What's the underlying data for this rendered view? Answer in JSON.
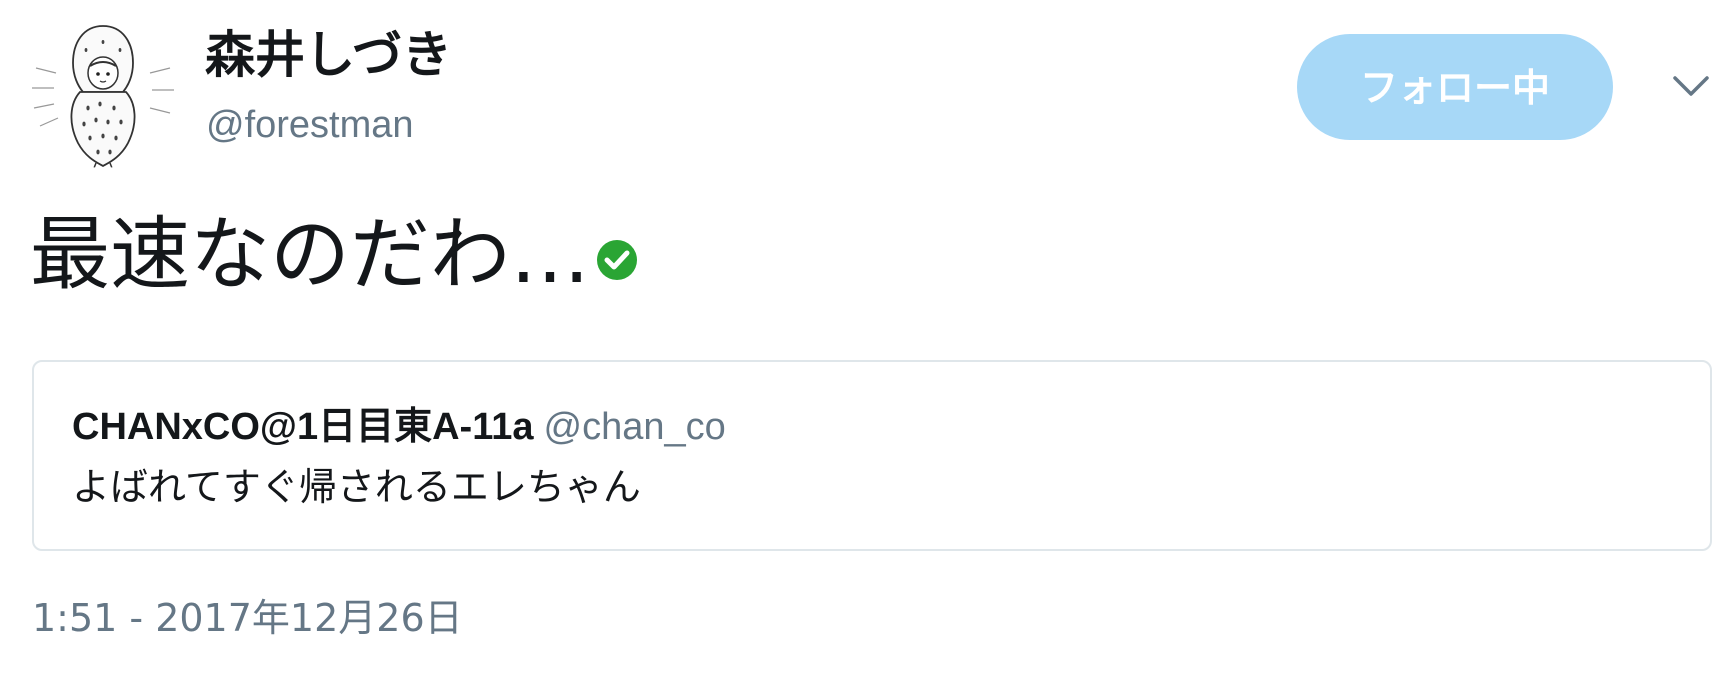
{
  "author": {
    "display_name": "森井しづき",
    "screen_name": "@forestman",
    "avatar_icon": "strawberry-costume-character-icon"
  },
  "actions": {
    "follow_label": "フォロー中",
    "more_icon": "chevron-down-icon"
  },
  "tweet": {
    "text": "最速なのだわ…",
    "emoji_icon": "check-mark-button-icon"
  },
  "quote": {
    "name": "CHANxCO@1日目東A-11a",
    "handle": "@chan_co",
    "text": "よばれてすぐ帰されるエレちゃん"
  },
  "timestamp": "1:51 - 2017年12月26日",
  "colors": {
    "follow_button_bg": "#a7d8f7",
    "secondary_text": "#657786",
    "primary_text": "#14171a",
    "card_border": "#dfe6ea",
    "check_green": "#2aa534"
  }
}
